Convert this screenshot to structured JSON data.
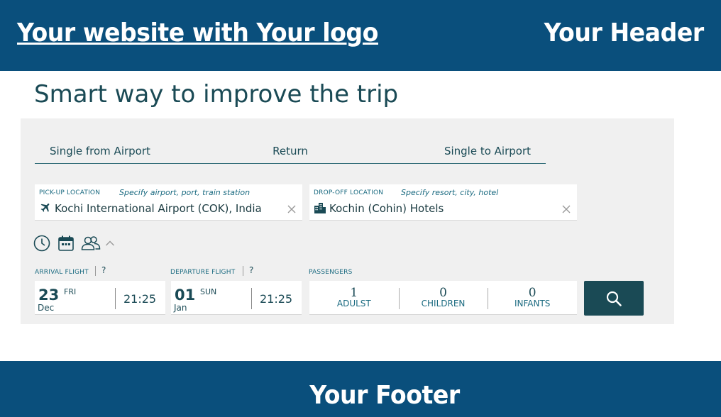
{
  "header": {
    "logo_text": "Your website with Your logo",
    "label": "Your Header"
  },
  "page": {
    "title": "Smart way to improve the trip"
  },
  "trip_tabs": [
    "Single from Airport",
    "Return",
    "Single to Airport"
  ],
  "pickup": {
    "label": "PICK-UP LOCATION",
    "hint": "Specify airport, port, train station",
    "value": "Kochi International Airport  (COK), India",
    "icon": "plane-icon"
  },
  "dropoff": {
    "label": "DROP-OFF LOCATION",
    "hint": "Specify resort, city, hotel",
    "value": "Kochin (Cohin) Hotels",
    "icon": "hotel-icon"
  },
  "options_icons": [
    "clock-icon",
    "calendar-icon",
    "passengers-icon",
    "chevron-up-icon"
  ],
  "arrival": {
    "label": "ARRIVAL FLIGHT",
    "help": "?",
    "day": "23",
    "dow": "FRI",
    "month": "Dec",
    "time": "21:25"
  },
  "departure": {
    "label": "DEPARTURE FLIGHT",
    "help": "?",
    "day": "01",
    "dow": "SUN",
    "month": "Jan",
    "time": "21:25"
  },
  "passengers": {
    "label": "PASSENGERS",
    "items": [
      {
        "count": "1",
        "label": "ADULST"
      },
      {
        "count": "0",
        "label": "CHILDREN"
      },
      {
        "count": "0",
        "label": "INFANTS"
      }
    ]
  },
  "search": {
    "icon": "search-icon"
  },
  "footer": {
    "label": "Your Footer"
  },
  "colors": {
    "brand": "#0a4f7c",
    "accent": "#1a4a55",
    "panel": "#f0f0f0"
  }
}
